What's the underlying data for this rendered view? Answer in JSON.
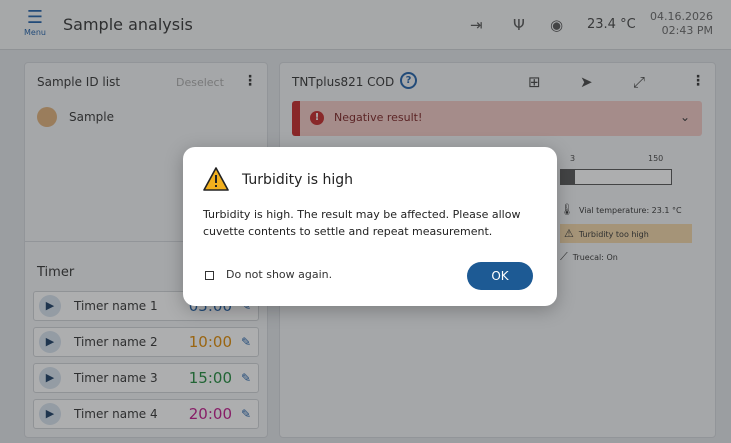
{
  "header": {
    "menu_icon": "hamburger-menu-icon",
    "menu_label": "Menu",
    "title": "Sample analysis",
    "icons": [
      "login-icon",
      "usb-icon",
      "user-icon"
    ],
    "temperature": "23.4 °C",
    "date": "04.16.2026",
    "time": "02:43 PM"
  },
  "sample_list": {
    "title": "Sample ID list",
    "deselect_label": "Deselect",
    "items": [
      {
        "label": "Sample",
        "color": "#e0b07a"
      }
    ]
  },
  "timers": {
    "title": "Timer",
    "items": [
      {
        "name": "Timer name 1",
        "value": "05:00",
        "color": "#1f5fa8"
      },
      {
        "name": "Timer name 2",
        "value": "10:00",
        "color": "#e08a00"
      },
      {
        "name": "Timer name 3",
        "value": "15:00",
        "color": "#1f8a3b"
      },
      {
        "name": "Timer name 4",
        "value": "20:00",
        "color": "#c2188b"
      }
    ]
  },
  "test": {
    "name": "TNTplus821 COD",
    "icons": [
      "add-box-icon",
      "send-icon",
      "expand-icon",
      "more-icon"
    ],
    "banner_text": "Negative result!",
    "scale": {
      "low": "3",
      "high": "150"
    },
    "info": {
      "vial_temperature": "Vial temperature: 23.1 °C",
      "turbidity": "Turbidity too high",
      "truecal": "Truecal: On"
    }
  },
  "dialog": {
    "title": "Turbidity is high",
    "message": "Turbidity is high. The result may be affected. Please allow cuvette contents to settle and repeat measurement.",
    "checkbox_label": "Do not show again.",
    "ok_label": "OK"
  },
  "colors": {
    "accent": "#1d5a94",
    "error": "#c62828",
    "warning": "#f2b01e"
  }
}
